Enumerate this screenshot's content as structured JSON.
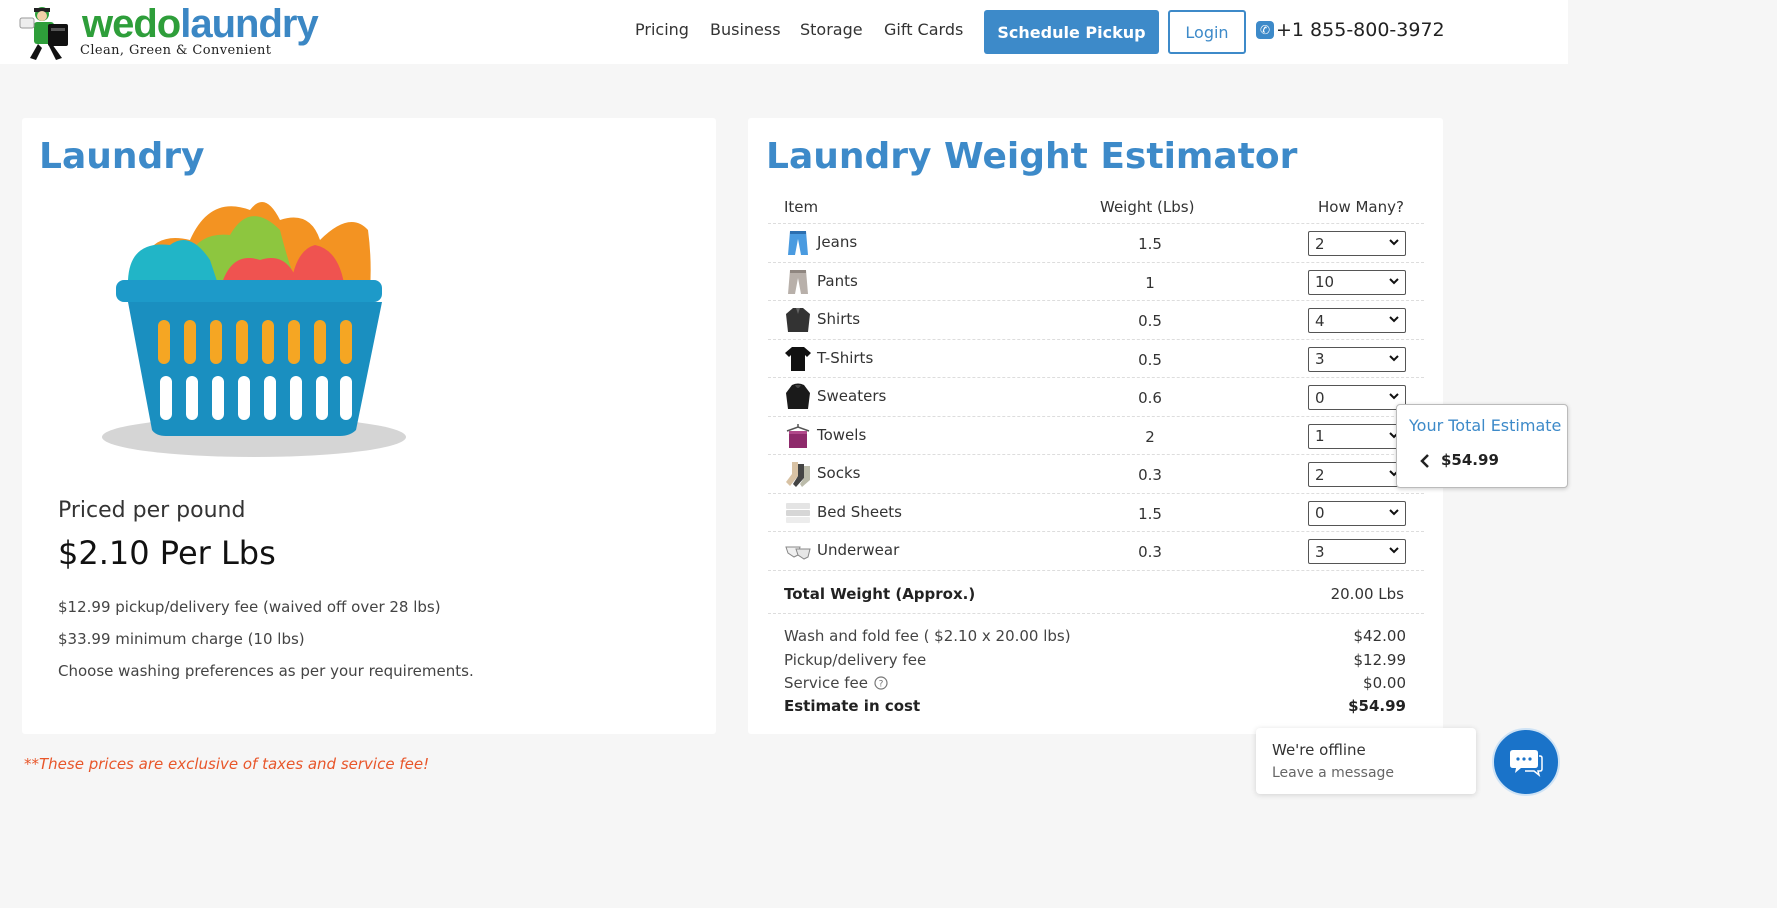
{
  "brand": {
    "logo_we": "wedo",
    "logo_laundry": "laundry",
    "tagline": "Clean, Green & Convenient",
    "blue": "#3d8ac9",
    "green": "#2e9e3a"
  },
  "nav": {
    "items": [
      "Pricing",
      "Business",
      "Storage",
      "Gift Cards"
    ],
    "schedule_label": "Schedule Pickup",
    "login_label": "Login",
    "phone": "+1 855-800-3972"
  },
  "laundry": {
    "title": "Laundry",
    "priced_per": "Priced per pound",
    "price": "$2.10 Per Lbs",
    "notes": [
      "$12.99 pickup/delivery fee (waived off over 28 lbs)",
      "$33.99 minimum charge (10 lbs)",
      "Choose washing preferences as per your requirements."
    ]
  },
  "estimator": {
    "title": "Laundry Weight Estimator",
    "headers": {
      "item": "Item",
      "weight": "Weight (Lbs)",
      "count": "How Many?"
    },
    "rows": [
      {
        "name": "Jeans",
        "weight": "1.5",
        "count": "2",
        "icon": "jeans-icon"
      },
      {
        "name": "Pants",
        "weight": "1",
        "count": "10",
        "icon": "pants-icon"
      },
      {
        "name": "Shirts",
        "weight": "0.5",
        "count": "4",
        "icon": "shirt-icon"
      },
      {
        "name": "T-Shirts",
        "weight": "0.5",
        "count": "3",
        "icon": "tshirt-icon"
      },
      {
        "name": "Sweaters",
        "weight": "0.6",
        "count": "0",
        "icon": "sweater-icon"
      },
      {
        "name": "Towels",
        "weight": "2",
        "count": "1",
        "icon": "towel-icon"
      },
      {
        "name": "Socks",
        "weight": "0.3",
        "count": "2",
        "icon": "socks-icon"
      },
      {
        "name": "Bed Sheets",
        "weight": "1.5",
        "count": "0",
        "icon": "bedsheet-icon"
      },
      {
        "name": "Underwear",
        "weight": "0.3",
        "count": "3",
        "icon": "underwear-icon"
      }
    ],
    "total_weight_label": "Total Weight (Approx.)",
    "total_weight": "20.00 Lbs",
    "wash_fold_label": "Wash and fold fee ( $2.10 x 20.00 lbs)",
    "wash_fold": "$42.00",
    "pickup_label": "Pickup/delivery fee",
    "pickup": "$12.99",
    "service_label": "Service fee",
    "service": "$0.00",
    "estimate_label": "Estimate in cost",
    "estimate": "$54.99"
  },
  "total_popup": {
    "title": "Your Total Estimate",
    "value": "$54.99"
  },
  "disclaimer": "**These prices are exclusive of taxes and service fee!",
  "chat": {
    "status": "We're offline",
    "action": "Leave a message"
  }
}
